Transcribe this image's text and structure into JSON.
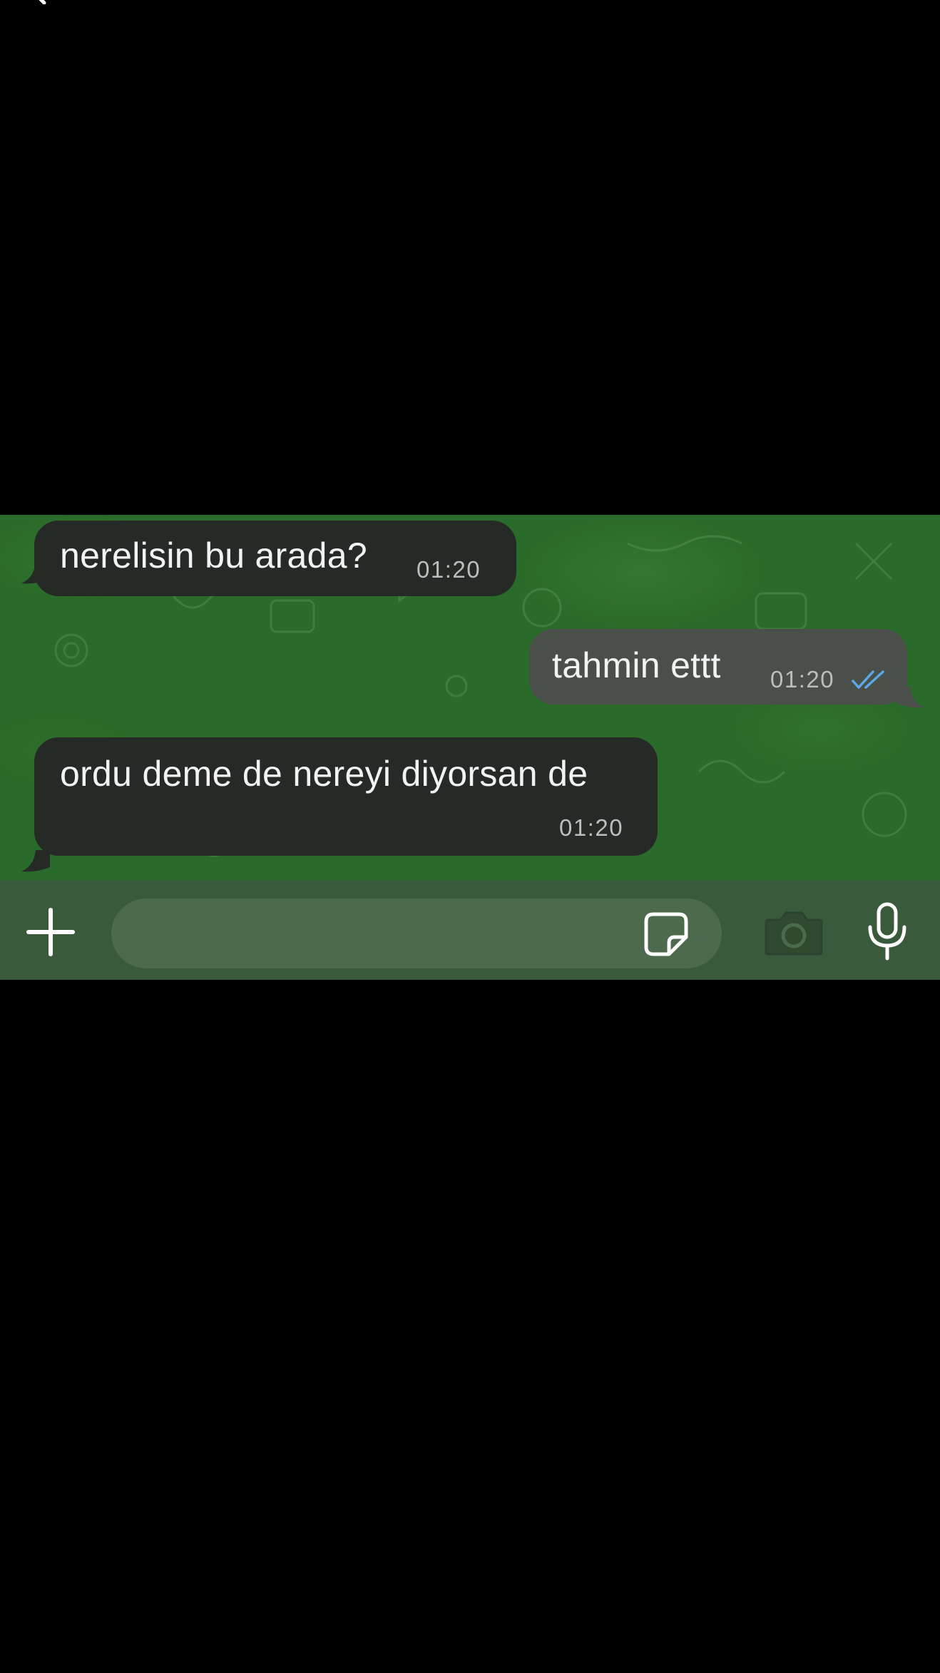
{
  "messages": [
    {
      "direction": "incoming",
      "text": "nerelisin bu arada?",
      "time": "01:20"
    },
    {
      "direction": "outgoing",
      "text": "tahmin ettt",
      "time": "01:20",
      "status": "read"
    },
    {
      "direction": "incoming",
      "text": "ordu deme de nereyi diyorsan de",
      "time": "01:20"
    }
  ],
  "input": {
    "placeholder": ""
  },
  "icons": {
    "back": "chevron-left-icon",
    "attach": "plus-icon",
    "sticker": "sticker-icon",
    "camera": "camera-icon",
    "mic": "microphone-icon",
    "read_status": "double-check-icon"
  },
  "colors": {
    "wallpaper": "#2a6a2a",
    "incoming_bubble": "#262a27",
    "outgoing_bubble": "#4a4f4a",
    "read_tick": "#5aa9e6",
    "input_bar": "#3a5a3c"
  }
}
